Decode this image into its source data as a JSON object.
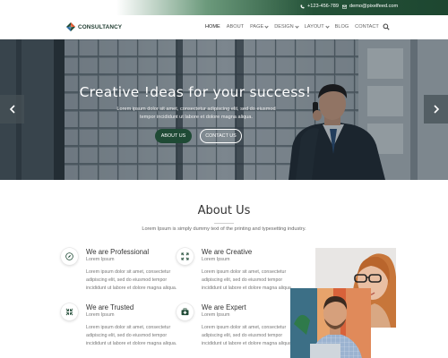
{
  "topbar": {
    "phone": "+123-456-789",
    "email": "demo@pixelfeed.com",
    "phone_icon": "phone-icon",
    "mail_icon": "mail-icon"
  },
  "brand": {
    "name": "CONSULTANCY",
    "logo_icon": "diamond-logo-icon",
    "colors": {
      "primary": "#1f4a35",
      "accent": "#e4572e",
      "dark": "#1d3a2e"
    }
  },
  "nav": {
    "items": [
      {
        "label": "HOME",
        "dropdown": false,
        "active": true
      },
      {
        "label": "ABOUT",
        "dropdown": false,
        "active": false
      },
      {
        "label": "PAGE",
        "dropdown": true,
        "active": false
      },
      {
        "label": "DESIGN",
        "dropdown": true,
        "active": false
      },
      {
        "label": "LAYOUT",
        "dropdown": true,
        "active": false
      },
      {
        "label": "BLOG",
        "dropdown": false,
        "active": false
      },
      {
        "label": "CONTACT",
        "dropdown": false,
        "active": false
      }
    ],
    "search_icon": "search-icon"
  },
  "hero": {
    "title": "Creative !deas for your success!",
    "text": "Lorem ipsum dolor sit amet, consectetur adipiscing elit, sed do eiusmod tempor incididunt ut labore et dolore magna aliqua.",
    "primary_button": "ABOUT US",
    "secondary_button": "CONTACT US",
    "prev_icon": "chevron-left-icon",
    "next_icon": "chevron-right-icon"
  },
  "about": {
    "title": "About Us",
    "subtitle": "Lorem Ipsum is simply dummy text of the printing and typesetting industry.",
    "features": [
      {
        "title": "We are Professional",
        "subtitle": "Lorem Ipsum",
        "body": "Lorem ipsum dolor sit amet, consectetur adipiscing elit, sed do eiusmod tempor incididunt ut labore et dolore magna aliqua.",
        "icon": "compass-icon"
      },
      {
        "title": "We are Creative",
        "subtitle": "Lorem Ipsum",
        "body": "Lorem ipsum dolor sit amet, consectetur adipiscing elit, sed do eiusmod tempor incididunt ut labore et dolore magna aliqua.",
        "icon": "expand-arrows-icon"
      },
      {
        "title": "We are Trusted",
        "subtitle": "Lorem Ipsum",
        "body": "Lorem ipsum dolor sit amet, consectetur adipiscing elit, sed do eiusmod tempor incididunt ut labore et dolore magna aliqua.",
        "icon": "compress-arrows-icon"
      },
      {
        "title": "We are Expert",
        "subtitle": "Lorem Ipsum",
        "body": "Lorem ipsum dolor sit amet, consectetur adipiscing elit, sed do eiusmod tempor incididunt ut labore et dolore magna aliqua.",
        "icon": "medkit-icon"
      }
    ]
  }
}
